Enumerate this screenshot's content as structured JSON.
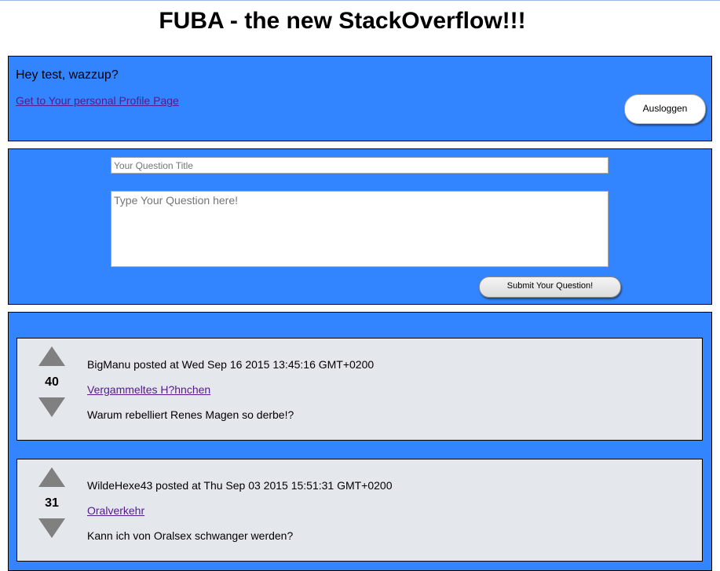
{
  "header": {
    "title": "FUBA - the new StackOverflow!!!"
  },
  "user_panel": {
    "greeting": "Hey test, wazzup?",
    "profile_link": "Get to Your personal Profile Page",
    "logout_label": "Ausloggen"
  },
  "ask_form": {
    "title_placeholder": "Your Question Title",
    "title_value": "",
    "body_placeholder": "Type Your Question here!",
    "body_value": "",
    "submit_label": "Submit Your Question!"
  },
  "questions": [
    {
      "votes": "40",
      "meta": "BigManu posted at Wed Sep 16 2015 13:45:16 GMT+0200",
      "title": "Vergammeltes H?hnchen",
      "body": "Warum rebelliert Renes Magen so derbe!?"
    },
    {
      "votes": "31",
      "meta": "WildeHexe43 posted at Thu Sep 03 2015 15:51:31 GMT+0200",
      "title": "Oralverkehr",
      "body": "Kann ich von Oralsex schwanger werden?"
    }
  ],
  "colors": {
    "panel_blue": "#3385ff",
    "card_gray": "#e4e7ec",
    "vote_arrow": "#808080",
    "visited_link": "#551a8b"
  }
}
